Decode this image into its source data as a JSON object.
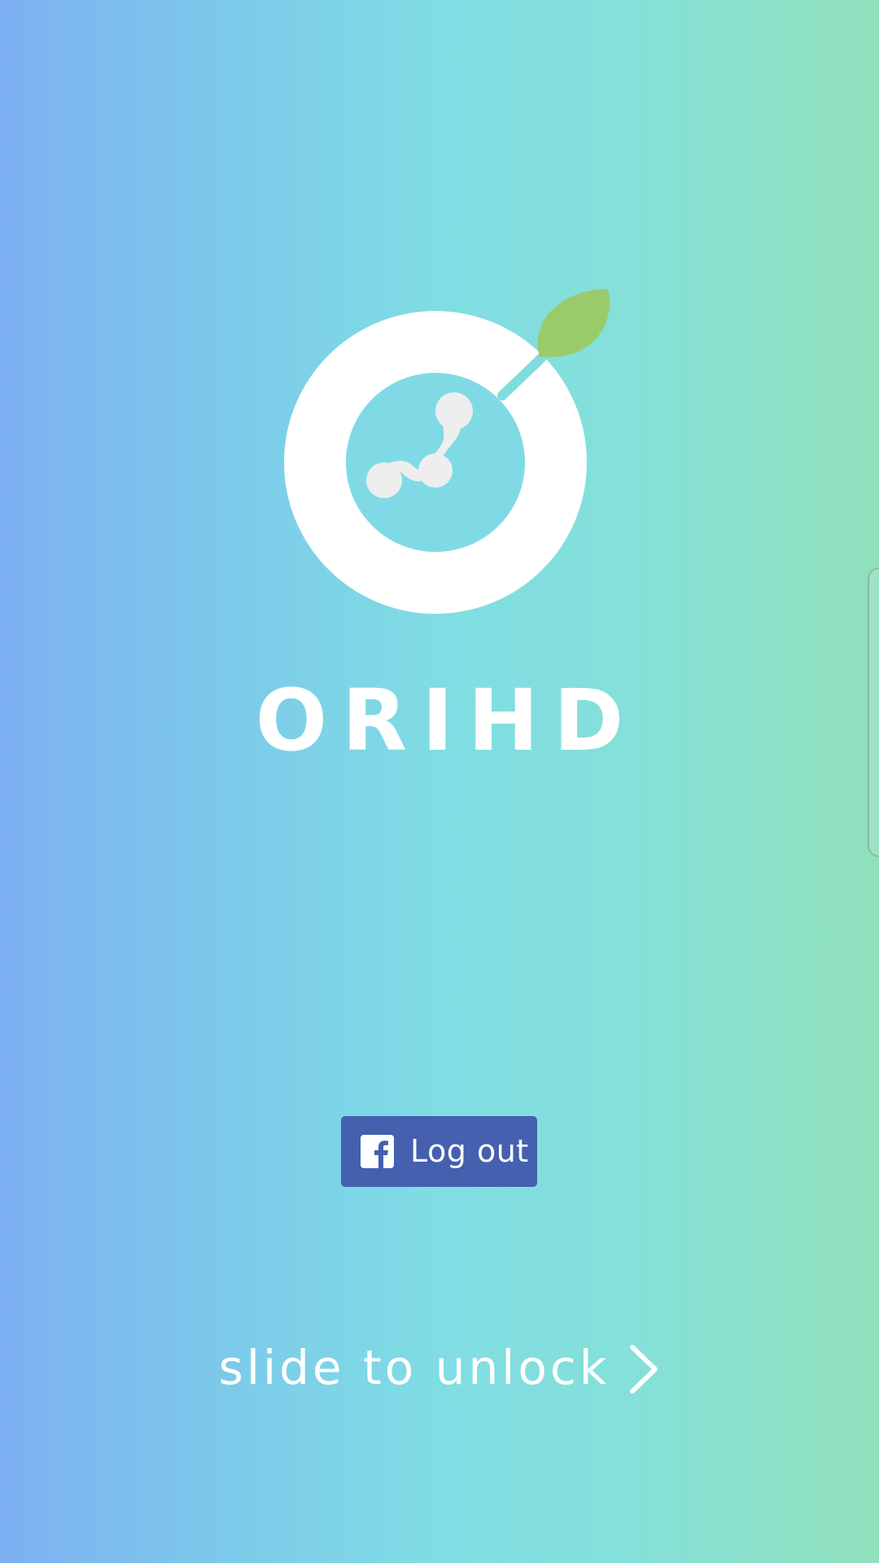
{
  "app": {
    "brand_name": "ORIHD",
    "logo_icon": "orange-fruit-logo-icon",
    "colors": {
      "gradient_left": "#7db0f2",
      "gradient_mid": "#80dde4",
      "gradient_right": "#90e0bb",
      "leaf": "#9acb6a",
      "logo_inner": "#80dae6",
      "molecule": "#eeeeee"
    }
  },
  "facebook": {
    "icon": "facebook-icon",
    "logout_label": "Log out",
    "color": "#4460ae"
  },
  "unlock": {
    "label": "slide to unlock",
    "icon": "chevron-right-icon"
  }
}
